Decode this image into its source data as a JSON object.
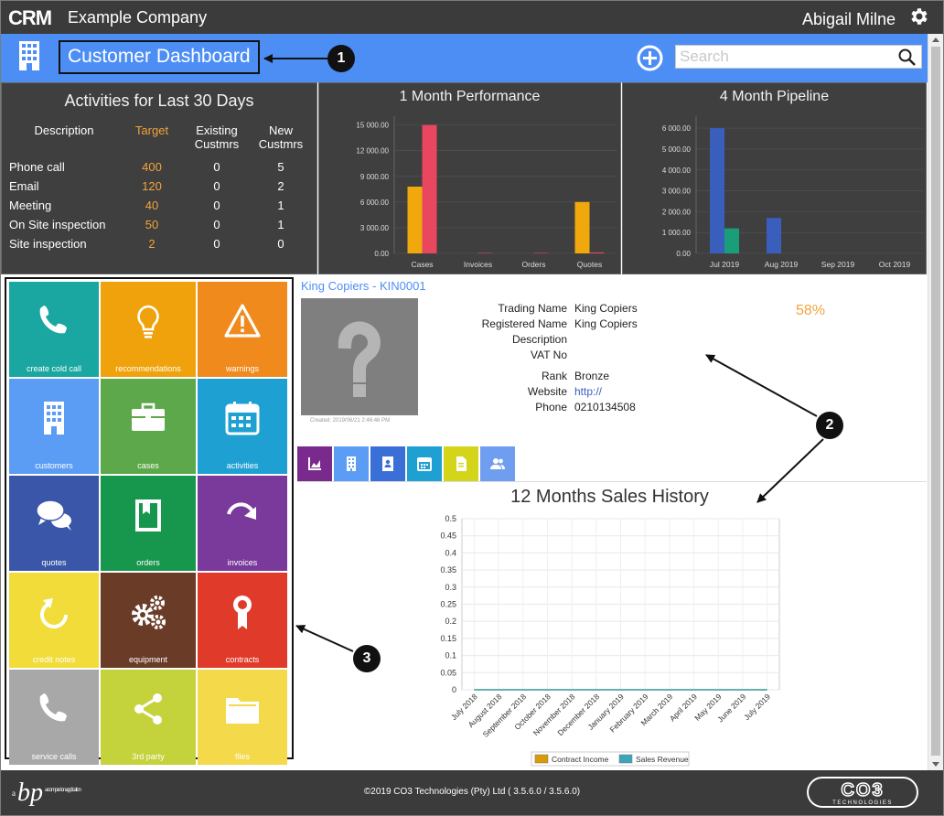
{
  "topbar": {
    "logo_text": "CRM",
    "company": "Example Company",
    "user": "Abigail Milne"
  },
  "header": {
    "title": "Customer Dashboard",
    "search_placeholder": "Search"
  },
  "activities": {
    "title": "Activities for Last 30 Days",
    "columns": [
      "Description",
      "Target",
      "Existing Custmrs",
      "New Custmrs"
    ],
    "rows": [
      {
        "description": "Phone call",
        "target": "400",
        "existing": "0",
        "new": "5"
      },
      {
        "description": "Email",
        "target": "120",
        "existing": "0",
        "new": "2"
      },
      {
        "description": "Meeting",
        "target": "40",
        "existing": "0",
        "new": "1"
      },
      {
        "description": "On Site inspection",
        "target": "50",
        "existing": "0",
        "new": "1"
      },
      {
        "description": "Site inspection",
        "target": "2",
        "existing": "0",
        "new": "0"
      }
    ]
  },
  "chart_data": [
    {
      "type": "bar",
      "title": "1 Month Performance",
      "categories": [
        "Cases",
        "Invoices",
        "Orders",
        "Quotes"
      ],
      "yticks": [
        "0.00",
        "3 000.00",
        "6 000.00",
        "9 000.00",
        "12 000.00",
        "15 000.00"
      ],
      "ylim": [
        0,
        15600
      ],
      "series": [
        {
          "color": "#f0a80c",
          "values": [
            7800,
            0,
            0,
            6000
          ]
        },
        {
          "color": "#e8475f",
          "values": [
            15000,
            60,
            60,
            120
          ]
        }
      ]
    },
    {
      "type": "bar",
      "title": "4 Month Pipeline",
      "categories": [
        "Jul 2019",
        "Aug 2019",
        "Sep 2019",
        "Oct 2019"
      ],
      "yticks": [
        "0.00",
        "1 000.00",
        "2 000.00",
        "3 000.00",
        "4 000.00",
        "5 000.00",
        "6 000.00"
      ],
      "ylim": [
        0,
        6400
      ],
      "series": [
        {
          "color": "#3a5ebc",
          "values": [
            6000,
            1700,
            0,
            0
          ]
        },
        {
          "color": "#1a9e7a",
          "values": [
            1200,
            0,
            0,
            0
          ]
        }
      ]
    },
    {
      "type": "line",
      "title": "12 Months Sales History",
      "categories": [
        "July 2018",
        "August 2018",
        "September 2018",
        "October 2018",
        "November 2018",
        "December 2018",
        "January 2019",
        "February 2019",
        "March 2019",
        "April 2019",
        "May 2019",
        "June 2019",
        "July 2019"
      ],
      "yticks": [
        "0",
        "0.05",
        "0.1",
        "0.15",
        "0.2",
        "0.25",
        "0.3",
        "0.35",
        "0.4",
        "0.45",
        "0.5"
      ],
      "ylim": [
        0,
        0.5
      ],
      "series": [
        {
          "name": "Contract Income",
          "color": "#d99a06",
          "values": [
            0,
            0,
            0,
            0,
            0,
            0,
            0,
            0,
            0,
            0,
            0,
            0,
            0
          ]
        },
        {
          "name": "Sales Revenue",
          "color": "#3aa6b9",
          "values": [
            0,
            0,
            0,
            0,
            0,
            0,
            0,
            0,
            0,
            0,
            0,
            0,
            0
          ]
        }
      ]
    }
  ],
  "tiles": [
    {
      "label": "create cold call",
      "color": "#1aa7a1",
      "icon": "phone-icon"
    },
    {
      "label": "recommendations",
      "color": "#f0a20c",
      "icon": "lightbulb-icon"
    },
    {
      "label": "warnings",
      "color": "#f08a1d",
      "icon": "warning-icon"
    },
    {
      "label": "customers",
      "color": "#5b9cf4",
      "icon": "building-icon"
    },
    {
      "label": "cases",
      "color": "#5ca84a",
      "icon": "briefcase-icon"
    },
    {
      "label": "activities",
      "color": "#1fa0d2",
      "icon": "calendar-icon"
    },
    {
      "label": "quotes",
      "color": "#3a56a8",
      "icon": "chat-bubbles-icon"
    },
    {
      "label": "orders",
      "color": "#17964e",
      "icon": "bookmark-book-icon"
    },
    {
      "label": "invoices",
      "color": "#7a3a9c",
      "icon": "redo-arrow-icon"
    },
    {
      "label": "credit notes",
      "color": "#f2dc3a",
      "icon": "undo-arrow-icon"
    },
    {
      "label": "equipment",
      "color": "#6a3c28",
      "icon": "gears-icon"
    },
    {
      "label": "contracts",
      "color": "#e03a2a",
      "icon": "award-ribbon-icon"
    },
    {
      "label": "service calls",
      "color": "#a8a8a8",
      "icon": "phone-icon"
    },
    {
      "label": "3rd party",
      "color": "#c4d23c",
      "icon": "share-icon"
    },
    {
      "label": "files",
      "color": "#f4d94a",
      "icon": "folder-icon"
    }
  ],
  "customer": {
    "heading": "King Copiers - KIN0001",
    "created": "Created: 2019/06/21 2:46:46 PM",
    "labels": [
      "Trading Name",
      "Registered Name",
      "Description",
      "VAT No",
      "Rank",
      "Website",
      "Phone"
    ],
    "trading_name": "King Copiers",
    "registered_name": "King Copiers",
    "description": "",
    "vat_no": "",
    "rank": "Bronze",
    "website": "http://",
    "phone": "0210134508",
    "percent": "58%"
  },
  "customer_tabs": [
    {
      "icon": "area-chart-icon",
      "color": "#7a2a8c"
    },
    {
      "icon": "building-icon",
      "color": "#5b9cf4"
    },
    {
      "icon": "contact-book-icon",
      "color": "#3a6fd8"
    },
    {
      "icon": "calendar-icon",
      "color": "#1fa0d2"
    },
    {
      "icon": "document-icon",
      "color": "#d4d41a"
    },
    {
      "icon": "users-icon",
      "color": "#6f9ef0"
    }
  ],
  "annotations": [
    "1",
    "2",
    "3"
  ],
  "footer": {
    "brand_text": "bp",
    "brand_caption": "a companion application",
    "copyright": "©2019 CO3 Technologies (Pty) Ltd ( 3.5.6.0 / 3.5.6.0)",
    "co3_text": "CO3",
    "co3_caption": "TECHNOLOGIES"
  }
}
